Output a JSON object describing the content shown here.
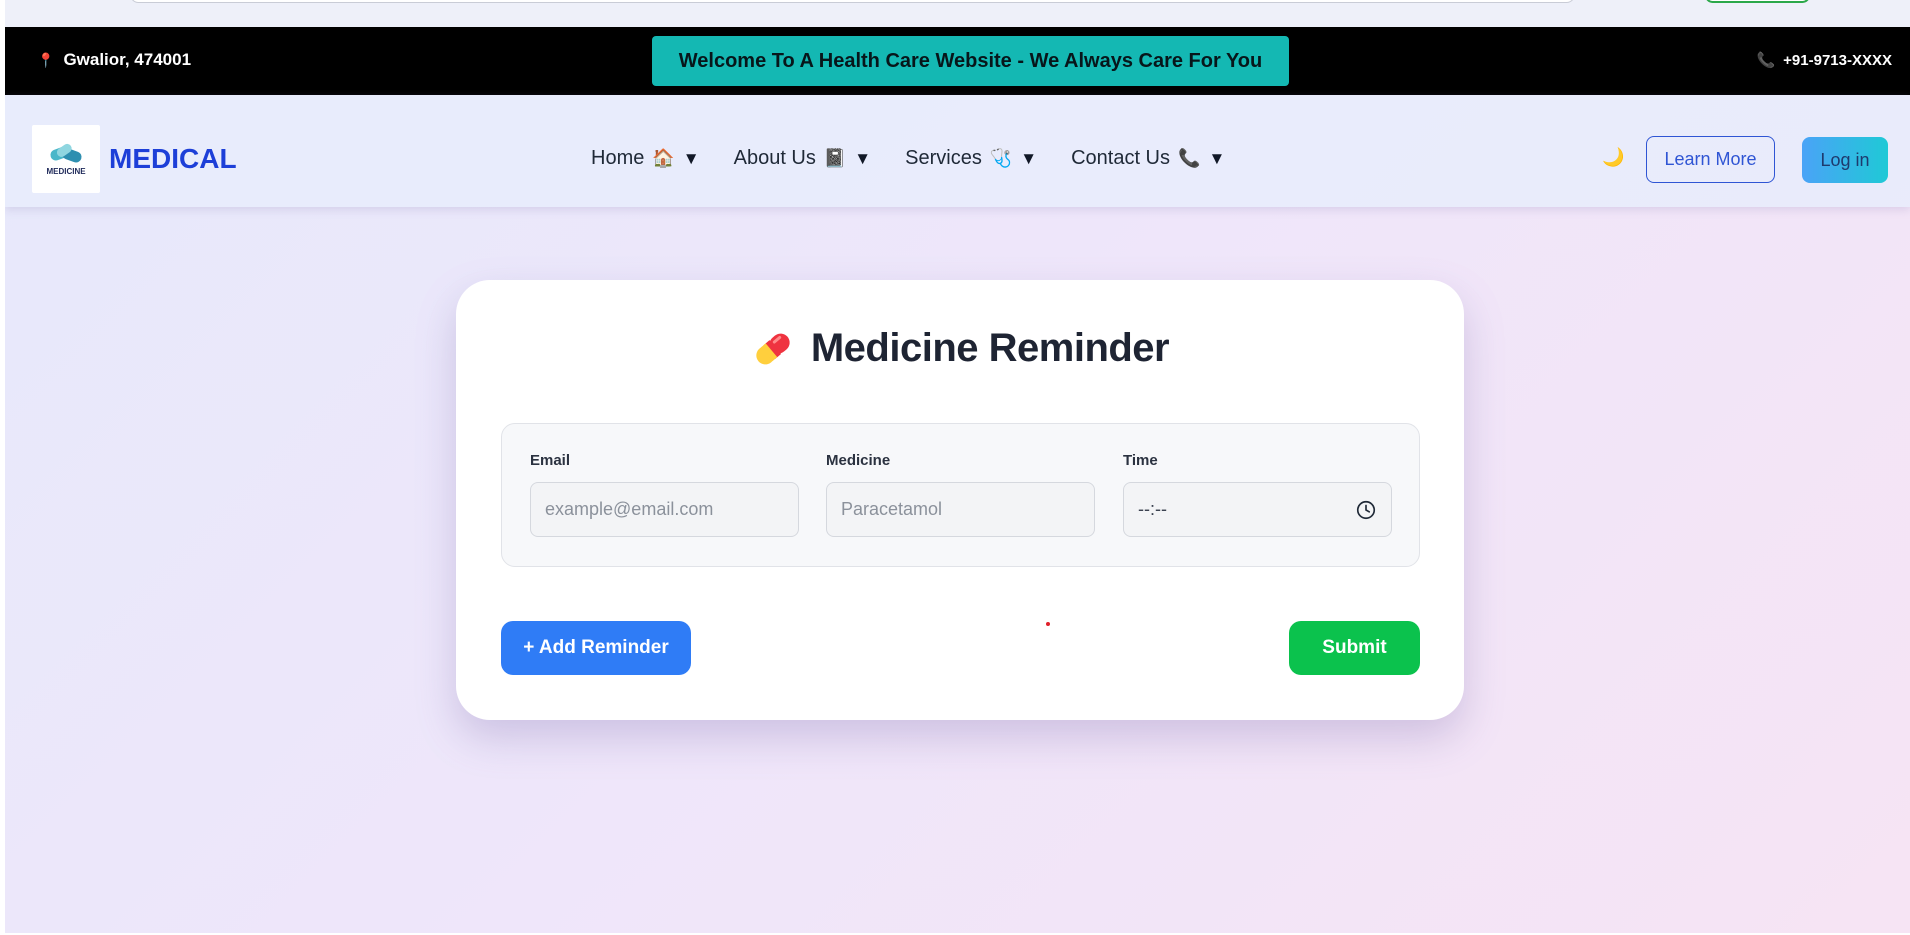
{
  "topbar": {
    "location": "Gwalior, 474001",
    "welcome": "Welcome To A Health Care Website - We Always Care For You",
    "phone": "+91-9713-XXXX",
    "pin_icon": "map-pin-icon",
    "phone_icon": "phone-icon"
  },
  "navbar": {
    "logo_word": "MEDICINE",
    "brand": "MEDICAL",
    "items": [
      {
        "label": "Home",
        "emoji": "🏠"
      },
      {
        "label": "About Us",
        "emoji": "📓"
      },
      {
        "label": "Services",
        "emoji": "🩺"
      },
      {
        "label": "Contact Us",
        "emoji": "📞"
      }
    ],
    "caret": "▼",
    "theme_toggle": "🌙",
    "learn_more": "Learn More",
    "login": "Log in"
  },
  "reminder": {
    "title_icon": "💊",
    "title": "Medicine Reminder",
    "fields": {
      "email": {
        "label": "Email",
        "placeholder": "example@email.com"
      },
      "medicine": {
        "label": "Medicine",
        "placeholder": "Paracetamol"
      },
      "time": {
        "label": "Time",
        "value": "--:--"
      }
    },
    "add_button": "+ Add Reminder",
    "submit_button": "Submit"
  },
  "colors": {
    "brand": "#1d3fd8",
    "welcome_bg": "#14b8b3",
    "add_button": "#2f7cf6",
    "submit_button": "#0bc24d"
  }
}
